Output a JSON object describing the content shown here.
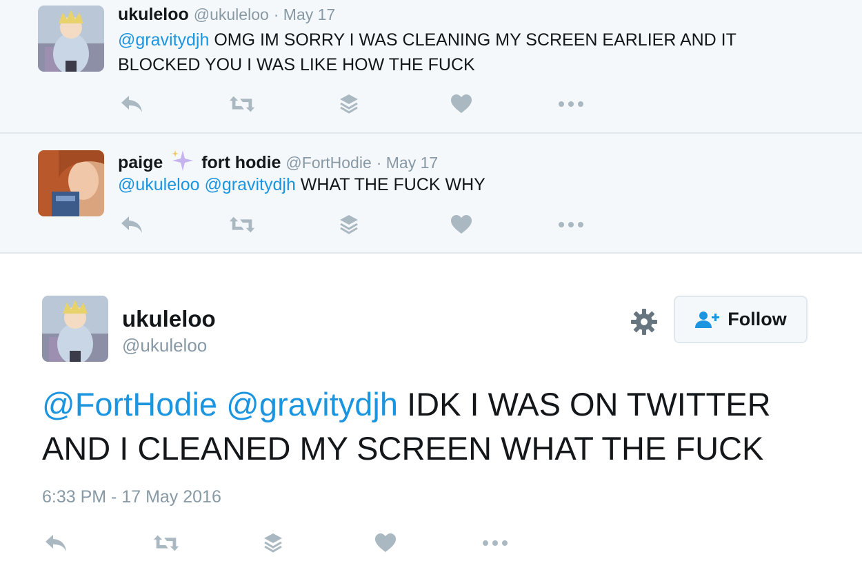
{
  "replies": [
    {
      "name": "ukuleloo",
      "name_suffix": "",
      "handle": "@ukuleloo",
      "date": "· May 17",
      "mentions": [
        "@gravitydjh"
      ],
      "text": "OMG IM SORRY I WAS CLEANING MY SCREEN EARLIER AND IT",
      "text_line2": "BLOCKED YOU I WAS LIKE HOW THE FUCK"
    },
    {
      "name": "paige",
      "name_suffix": "fort hodie",
      "handle": "@FortHodie",
      "date": "· May 17",
      "mentions": [
        "@ukuleloo",
        "@gravitydjh"
      ],
      "text": "WHAT THE FUCK WHY"
    }
  ],
  "main_tweet": {
    "name": "ukuleloo",
    "handle": "@ukuleloo",
    "follow_label": "Follow",
    "mentions": [
      "@FortHodie",
      "@gravitydjh"
    ],
    "text_line1": "IDK I WAS ON TWITTER",
    "text_line2": "AND I CLEANED MY SCREEN WHAT THE FUCK",
    "timestamp": "6:33 PM - 17 May 2016"
  },
  "colors": {
    "mention": "#1b95e0",
    "muted": "#8899a6",
    "reply_bg": "#f5f8fa",
    "icon": "#aab8c2"
  },
  "icons": [
    "reply-icon",
    "retweet-icon",
    "stack-icon",
    "heart-icon",
    "more-icon",
    "sparkles-icon",
    "gear-icon",
    "add-user-icon"
  ]
}
